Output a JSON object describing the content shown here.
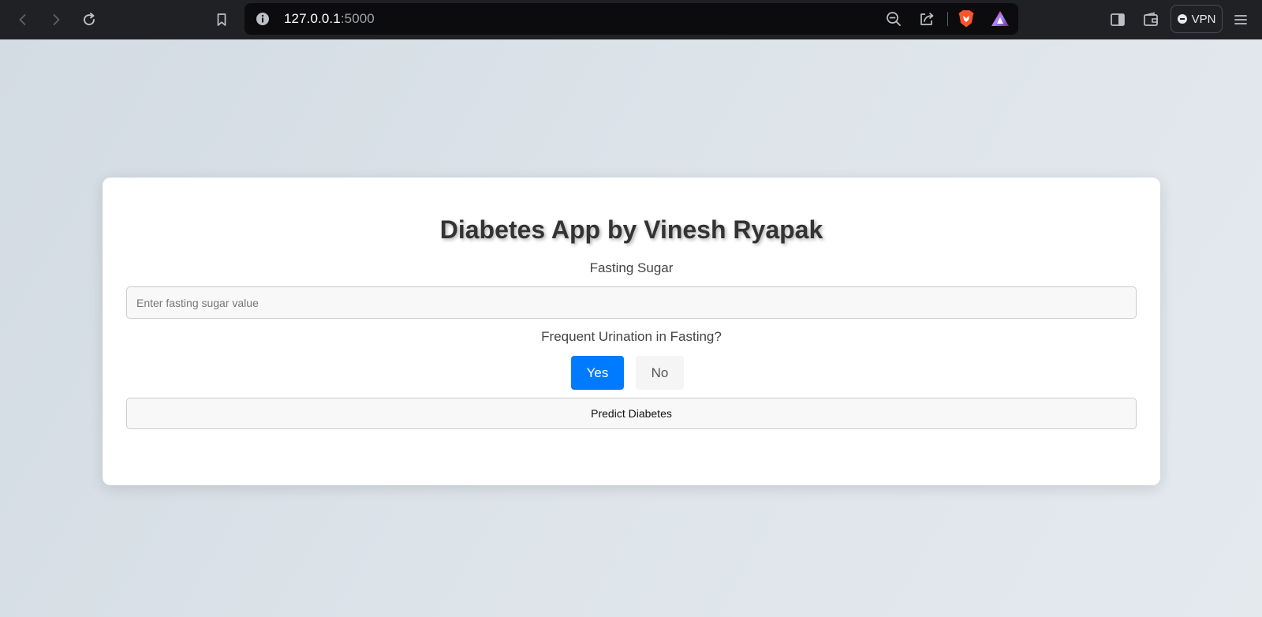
{
  "browser": {
    "url_host": "127.0.0.1",
    "url_port": ":5000",
    "vpn_label": "VPN"
  },
  "app": {
    "title": "Diabetes App by Vinesh Ryapak",
    "fasting_label": "Fasting Sugar",
    "fasting_placeholder": "Enter fasting sugar value",
    "fasting_value": "",
    "urination_label": "Frequent Urination in Fasting?",
    "yes_label": "Yes",
    "no_label": "No",
    "selected_option": "Yes",
    "predict_label": "Predict Diabetes"
  },
  "colors": {
    "primary": "#007bff",
    "chrome": "#202124",
    "brave": "#fb542b"
  }
}
